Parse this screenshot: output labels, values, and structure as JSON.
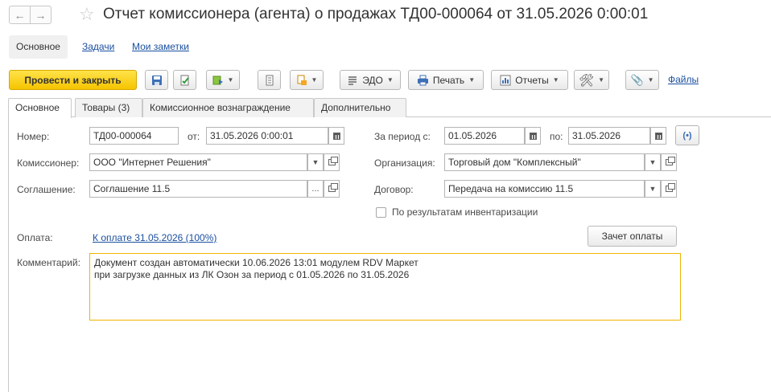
{
  "window": {
    "title": "Отчет комиссионера (агента) о продажах ТД00-000064 от 31.05.2026 0:00:01"
  },
  "sections": {
    "main": "Основное",
    "tasks": "Задачи",
    "notes": "Мои заметки"
  },
  "toolbar": {
    "post_close": "Провести и закрыть",
    "edo": "ЭДО",
    "print": "Печать",
    "reports": "Отчеты",
    "files": "Файлы"
  },
  "tabs": [
    {
      "label": "Основное",
      "active": true
    },
    {
      "label": "Товары (3)",
      "active": false
    },
    {
      "label": "Комиссионное вознаграждение",
      "active": false
    },
    {
      "label": "Дополнительно",
      "active": false
    }
  ],
  "form": {
    "number_label": "Номер:",
    "number_value": "ТД00-000064",
    "date_label": "от:",
    "date_value": "31.05.2026  0:00:01",
    "period_label": "За период с:",
    "period_from": "01.05.2026",
    "period_to_label": "по:",
    "period_to": "31.05.2026",
    "commissioner_label": "Комиссионер:",
    "commissioner_value": "ООО \"Интернет Решения\"",
    "organization_label": "Организация:",
    "organization_value": "Торговый дом \"Комплексный\"",
    "agreement_label": "Соглашение:",
    "agreement_value": "Соглашение 11.5",
    "contract_label": "Договор:",
    "contract_value": "Передача на комиссию 11.5",
    "inventory_label": "По результатам инвентаризации",
    "inventory_checked": false,
    "payment_label": "Оплата:",
    "payment_link": "К оплате 31.05.2026 (100%)",
    "payment_offset_button": "Зачет оплаты",
    "comment_label": "Комментарий:",
    "comment_line1": "Документ создан автоматически 10.06.2026 13:01 модулем RDV Маркет",
    "comment_line2": "при загрузке данных из ЛК Озон за период с 01.05.2026 по 31.05.2026"
  },
  "colors": {
    "primary_button": "#f5c400",
    "link": "#1a4fa0",
    "comment_border": "#f0b400"
  }
}
